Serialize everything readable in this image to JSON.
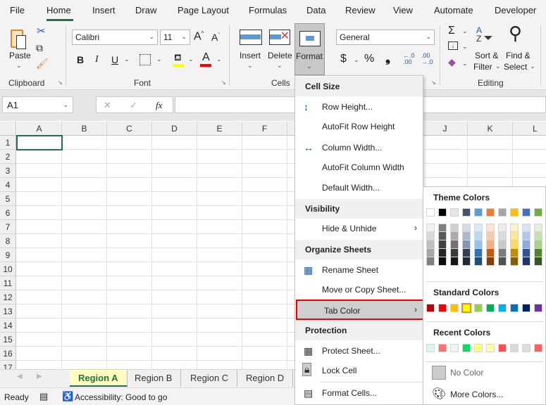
{
  "menu_tabs": [
    "File",
    "Home",
    "Insert",
    "Draw",
    "Page Layout",
    "Formulas",
    "Data",
    "Review",
    "View",
    "Automate",
    "Developer"
  ],
  "active_tab": "Home",
  "ribbon": {
    "clipboard": {
      "paste": "Paste",
      "label": "Clipboard"
    },
    "font": {
      "name": "Calibri",
      "size": "11",
      "bold": "B",
      "italic": "I",
      "underline": "U",
      "label": "Font",
      "fill_color": "#FFFF00",
      "font_color": "#FF0000"
    },
    "cells": {
      "insert": "Insert",
      "delete": "Delete",
      "format": "Format",
      "label": "Cells"
    },
    "number": {
      "format": "General",
      "currency": "$",
      "percent": "%",
      "comma": "❟"
    },
    "editing": {
      "sort": "Sort &",
      "filter": "Filter",
      "find": "Find &",
      "select": "Select",
      "label": "Editing"
    }
  },
  "formula_bar": {
    "name_box": "A1",
    "cancel": "✕",
    "enter": "✓",
    "fx": "fx",
    "value": ""
  },
  "columns": [
    "A",
    "B",
    "C",
    "D",
    "E",
    "F",
    "G",
    "H",
    "I",
    "J",
    "K",
    "L"
  ],
  "rows": [
    "1",
    "2",
    "3",
    "4",
    "5",
    "6",
    "7",
    "8",
    "9",
    "10",
    "11",
    "12",
    "13",
    "14",
    "15",
    "16",
    "17"
  ],
  "sheet_tabs": [
    "Region A",
    "Region B",
    "Region C",
    "Region D"
  ],
  "active_sheet": "Region A",
  "status": {
    "mode": "Ready",
    "accessibility": "Accessibility: Good to go"
  },
  "format_menu": {
    "cell_size": "Cell Size",
    "row_height": "Row Height...",
    "autofit_row": "AutoFit Row Height",
    "column_width": "Column Width...",
    "autofit_column": "AutoFit Column Width",
    "default_width": "Default Width...",
    "visibility": "Visibility",
    "hide_unhide": "Hide & Unhide",
    "organize": "Organize Sheets",
    "rename": "Rename Sheet",
    "move_copy": "Move or Copy Sheet...",
    "tab_color": "Tab Color",
    "protection": "Protection",
    "protect_sheet": "Protect Sheet...",
    "lock_cell": "Lock Cell",
    "format_cells": "Format Cells..."
  },
  "color_menu": {
    "theme_label": "Theme Colors",
    "theme": [
      "#FFFFFF",
      "#000000",
      "#E7E6E6",
      "#44546A",
      "#5B9BD5",
      "#ED7D31",
      "#A5A5A5",
      "#FFC000",
      "#4472C4",
      "#70AD47"
    ],
    "shades": [
      [
        "#F2F2F2",
        "#D9D9D9",
        "#BFBFBF",
        "#A6A6A6",
        "#808080"
      ],
      [
        "#808080",
        "#595959",
        "#404040",
        "#262626",
        "#0D0D0D"
      ],
      [
        "#D0CECE",
        "#AEAAAA",
        "#767171",
        "#3B3838",
        "#171616"
      ],
      [
        "#D6DCE4",
        "#ACB9CA",
        "#8497B0",
        "#333F4F",
        "#222B35"
      ],
      [
        "#DDEBF7",
        "#BDD7EE",
        "#9BC2E6",
        "#2F75B5",
        "#1F4E78"
      ],
      [
        "#FCE4D6",
        "#F8CBAD",
        "#F4B084",
        "#C65911",
        "#833C0C"
      ],
      [
        "#EDEDED",
        "#DBDBDB",
        "#C9C9C9",
        "#7B7B7B",
        "#525252"
      ],
      [
        "#FFF2CC",
        "#FFE699",
        "#FFD966",
        "#BF8F00",
        "#806000"
      ],
      [
        "#D9E1F2",
        "#B4C6E7",
        "#8EA9DB",
        "#305496",
        "#203764"
      ],
      [
        "#E2EFDA",
        "#C6E0B4",
        "#A9D08E",
        "#548235",
        "#375623"
      ]
    ],
    "standard_label": "Standard Colors",
    "standard": [
      "#C00000",
      "#FF0000",
      "#FFC000",
      "#FFFF00",
      "#92D050",
      "#00B050",
      "#00B0F0",
      "#0070C0",
      "#002060",
      "#7030A0"
    ],
    "standard_selected": "#FFFF00",
    "recent_label": "Recent Colors",
    "recent": [
      "#DDF5EB",
      "#FF7070",
      "#F2F2F2",
      "#00E060",
      "#FFFF80",
      "#FFFFA8",
      "#FF4F4F",
      "#D9D9D9",
      "#DDDDDD",
      "#FF6060"
    ],
    "no_color": "No Color",
    "more_colors": "More Colors..."
  }
}
